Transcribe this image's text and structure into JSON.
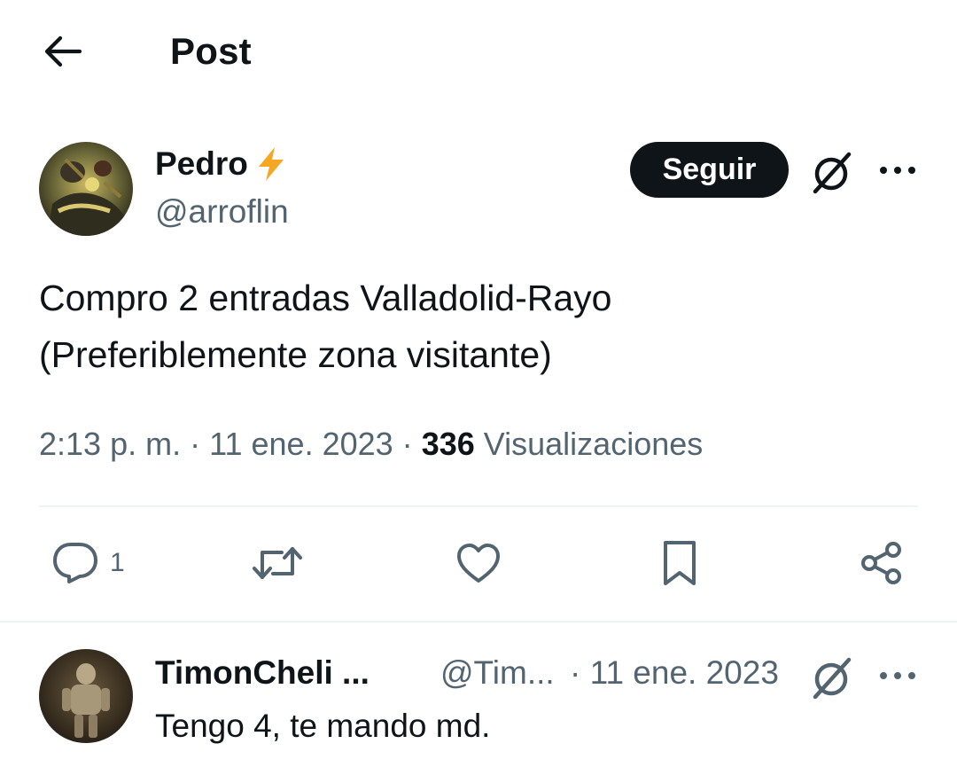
{
  "header": {
    "back_icon": "arrow-left-icon",
    "title": "Post"
  },
  "post": {
    "author": {
      "name": "Pedro",
      "badge_icon": "lightning-bolt-icon",
      "badge_color": "#f5a623",
      "handle": "@arroflin",
      "avatar_icon": "avatar-image"
    },
    "follow_label": "Seguir",
    "grok_icon": "grok-icon",
    "more_icon": "more-horizontal-icon",
    "text_line1": "Compro 2 entradas Valladolid-Rayo",
    "text_line2": "(Preferiblemente zona visitante)",
    "time": "2:13 p. m.",
    "separator": "·",
    "date": "11 ene. 2023",
    "views_count": "336",
    "views_label": "Visualizaciones",
    "actions": {
      "reply_icon": "reply-icon",
      "reply_count": "1",
      "repost_icon": "repost-icon",
      "like_icon": "heart-icon",
      "bookmark_icon": "bookmark-icon",
      "share_icon": "share-icon"
    }
  },
  "reply": {
    "author_name": "TimonCheli ...",
    "handle": "@Tim...",
    "separator": "·",
    "date": "11 ene. 2023",
    "text": "Tengo 4, te mando md.",
    "avatar_icon": "avatar-image"
  },
  "colors": {
    "text_primary": "#0f1419",
    "text_secondary": "#536471",
    "divider": "#eff3f4",
    "follow_bg": "#0f1419"
  }
}
